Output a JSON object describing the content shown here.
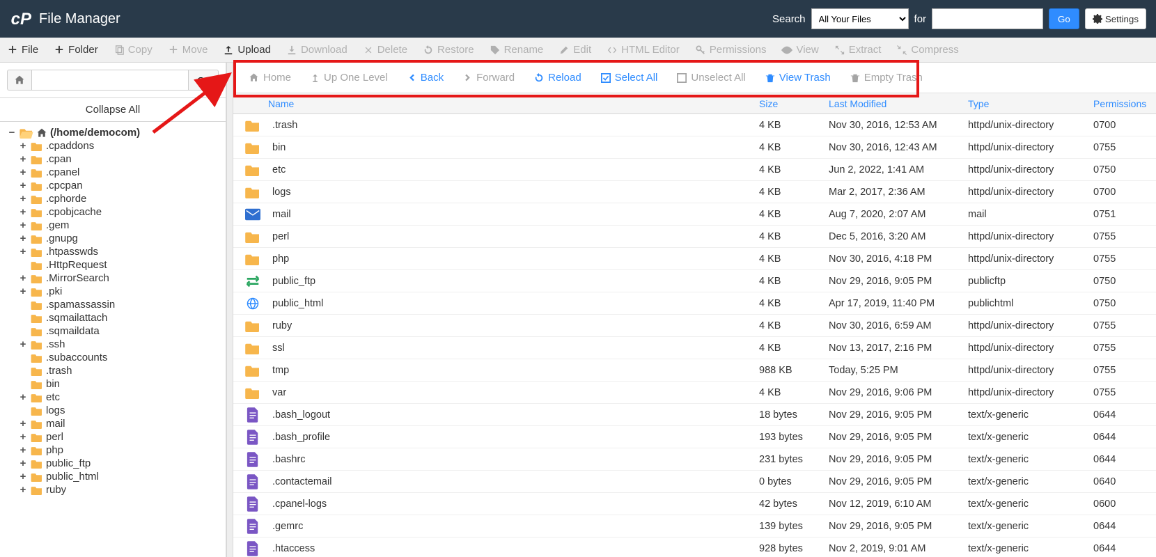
{
  "app_title": "File Manager",
  "search": {
    "label": "Search",
    "scope_selected": "All Your Files",
    "for_label": "for",
    "go_label": "Go",
    "settings_label": "Settings"
  },
  "toolbar1": {
    "file": "File",
    "folder": "Folder",
    "copy": "Copy",
    "move": "Move",
    "upload": "Upload",
    "download": "Download",
    "delete": "Delete",
    "restore": "Restore",
    "rename": "Rename",
    "edit": "Edit",
    "html_editor": "HTML Editor",
    "permissions": "Permissions",
    "view": "View",
    "extract": "Extract",
    "compress": "Compress"
  },
  "toolbar2": {
    "home": "Home",
    "up": "Up One Level",
    "back": "Back",
    "forward": "Forward",
    "reload": "Reload",
    "select_all": "Select All",
    "unselect_all": "Unselect All",
    "view_trash": "View Trash",
    "empty_trash": "Empty Trash"
  },
  "path": {
    "go": "Go",
    "collapse_all": "Collapse All"
  },
  "tree": {
    "root": "(/home/democom)",
    "items": [
      {
        "n": ".cpaddons",
        "t": "+"
      },
      {
        "n": ".cpan",
        "t": ""
      },
      {
        "n": ".cpanel",
        "t": "+"
      },
      {
        "n": ".cpcpan",
        "t": "+"
      },
      {
        "n": ".cphorde",
        "t": "+"
      },
      {
        "n": ".cpobjcache",
        "t": "+"
      },
      {
        "n": ".gem",
        "t": "+"
      },
      {
        "n": ".gnupg",
        "t": "+"
      },
      {
        "n": ".htpasswds",
        "t": "+"
      },
      {
        "n": ".HttpRequest",
        "t": "",
        "noplus": true
      },
      {
        "n": ".MirrorSearch",
        "t": "+"
      },
      {
        "n": ".pki",
        "t": "+"
      },
      {
        "n": ".spamassassin",
        "t": "",
        "noplus": true
      },
      {
        "n": ".sqmailattach",
        "t": "",
        "noplus": true
      },
      {
        "n": ".sqmaildata",
        "t": "",
        "noplus": true
      },
      {
        "n": ".ssh",
        "t": "+"
      },
      {
        "n": ".subaccounts",
        "t": "",
        "noplus": true
      },
      {
        "n": ".trash",
        "t": "",
        "noplus": true
      },
      {
        "n": "bin",
        "t": "",
        "noplus": true
      },
      {
        "n": "etc",
        "t": "+"
      },
      {
        "n": "logs",
        "t": "",
        "noplus": true
      },
      {
        "n": "mail",
        "t": "+"
      },
      {
        "n": "perl",
        "t": "+"
      },
      {
        "n": "php",
        "t": "+"
      },
      {
        "n": "public_ftp",
        "t": "+"
      },
      {
        "n": "public_html",
        "t": "+"
      },
      {
        "n": "ruby",
        "t": "+"
      }
    ]
  },
  "columns": {
    "name": "Name",
    "size": "Size",
    "modified": "Last Modified",
    "type": "Type",
    "perm": "Permissions"
  },
  "rows": [
    {
      "icon": "folder",
      "name": ".trash",
      "size": "4 KB",
      "mod": "Nov 30, 2016, 12:53 AM",
      "type": "httpd/unix-directory",
      "perm": "0700"
    },
    {
      "icon": "folder",
      "name": "bin",
      "size": "4 KB",
      "mod": "Nov 30, 2016, 12:43 AM",
      "type": "httpd/unix-directory",
      "perm": "0755"
    },
    {
      "icon": "folder",
      "name": "etc",
      "size": "4 KB",
      "mod": "Jun 2, 2022, 1:41 AM",
      "type": "httpd/unix-directory",
      "perm": "0750"
    },
    {
      "icon": "folder",
      "name": "logs",
      "size": "4 KB",
      "mod": "Mar 2, 2017, 2:36 AM",
      "type": "httpd/unix-directory",
      "perm": "0700"
    },
    {
      "icon": "mail",
      "name": "mail",
      "size": "4 KB",
      "mod": "Aug 7, 2020, 2:07 AM",
      "type": "mail",
      "perm": "0751"
    },
    {
      "icon": "folder",
      "name": "perl",
      "size": "4 KB",
      "mod": "Dec 5, 2016, 3:20 AM",
      "type": "httpd/unix-directory",
      "perm": "0755"
    },
    {
      "icon": "folder",
      "name": "php",
      "size": "4 KB",
      "mod": "Nov 30, 2016, 4:18 PM",
      "type": "httpd/unix-directory",
      "perm": "0755"
    },
    {
      "icon": "ftp",
      "name": "public_ftp",
      "size": "4 KB",
      "mod": "Nov 29, 2016, 9:05 PM",
      "type": "publicftp",
      "perm": "0750"
    },
    {
      "icon": "globe",
      "name": "public_html",
      "size": "4 KB",
      "mod": "Apr 17, 2019, 11:40 PM",
      "type": "publichtml",
      "perm": "0750"
    },
    {
      "icon": "folder",
      "name": "ruby",
      "size": "4 KB",
      "mod": "Nov 30, 2016, 6:59 AM",
      "type": "httpd/unix-directory",
      "perm": "0755"
    },
    {
      "icon": "folder",
      "name": "ssl",
      "size": "4 KB",
      "mod": "Nov 13, 2017, 2:16 PM",
      "type": "httpd/unix-directory",
      "perm": "0755"
    },
    {
      "icon": "folder",
      "name": "tmp",
      "size": "988 KB",
      "mod": "Today, 5:25 PM",
      "type": "httpd/unix-directory",
      "perm": "0755"
    },
    {
      "icon": "folder",
      "name": "var",
      "size": "4 KB",
      "mod": "Nov 29, 2016, 9:06 PM",
      "type": "httpd/unix-directory",
      "perm": "0755"
    },
    {
      "icon": "file",
      "name": ".bash_logout",
      "size": "18 bytes",
      "mod": "Nov 29, 2016, 9:05 PM",
      "type": "text/x-generic",
      "perm": "0644"
    },
    {
      "icon": "file",
      "name": ".bash_profile",
      "size": "193 bytes",
      "mod": "Nov 29, 2016, 9:05 PM",
      "type": "text/x-generic",
      "perm": "0644"
    },
    {
      "icon": "file",
      "name": ".bashrc",
      "size": "231 bytes",
      "mod": "Nov 29, 2016, 9:05 PM",
      "type": "text/x-generic",
      "perm": "0644"
    },
    {
      "icon": "file",
      "name": ".contactemail",
      "size": "0 bytes",
      "mod": "Nov 29, 2016, 9:05 PM",
      "type": "text/x-generic",
      "perm": "0640"
    },
    {
      "icon": "file",
      "name": ".cpanel-logs",
      "size": "42 bytes",
      "mod": "Nov 12, 2019, 6:10 AM",
      "type": "text/x-generic",
      "perm": "0600"
    },
    {
      "icon": "file",
      "name": ".gemrc",
      "size": "139 bytes",
      "mod": "Nov 29, 2016, 9:05 PM",
      "type": "text/x-generic",
      "perm": "0644"
    },
    {
      "icon": "file",
      "name": ".htaccess",
      "size": "928 bytes",
      "mod": "Nov 2, 2019, 9:01 AM",
      "type": "text/x-generic",
      "perm": "0644"
    }
  ]
}
